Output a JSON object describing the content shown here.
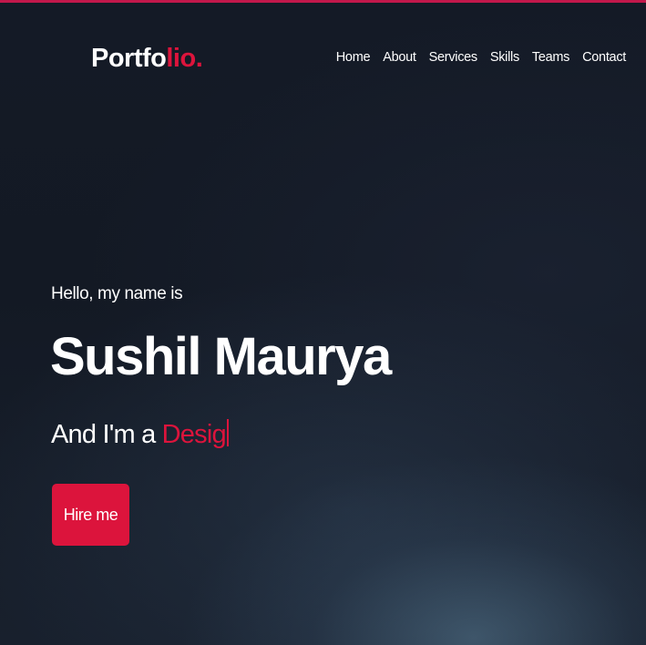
{
  "brand": {
    "logo_main": "Portfo",
    "logo_accent": "lio."
  },
  "nav": {
    "items": [
      "Home",
      "About",
      "Services",
      "Skills",
      "Teams",
      "Contact"
    ]
  },
  "hero": {
    "intro": "Hello, my name is",
    "name": "Sushil Maurya",
    "role_prefix": "And I'm a ",
    "role_typed": "Desig",
    "cta_label": "Hire me"
  },
  "colors": {
    "accent": "#dc143c",
    "background": "#111621",
    "text": "#ffffff"
  }
}
